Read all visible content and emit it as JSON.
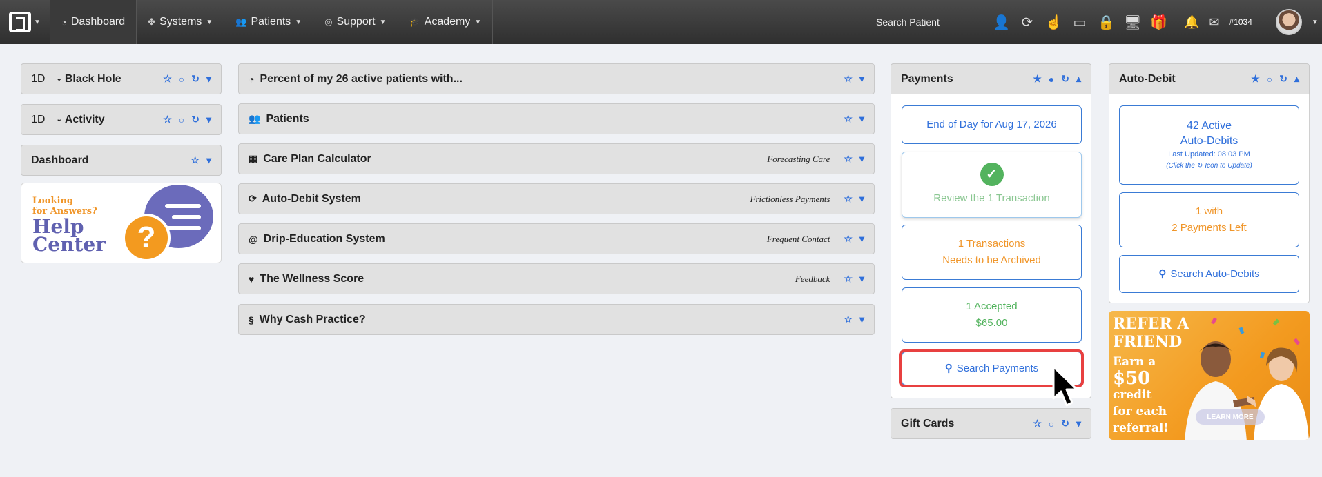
{
  "nav": {
    "items": [
      {
        "label": "Dashboard",
        "icon": "tachometer-icon"
      },
      {
        "label": "Systems",
        "icon": "puzzle-icon"
      },
      {
        "label": "Patients",
        "icon": "users-icon"
      },
      {
        "label": "Support",
        "icon": "life-ring-icon"
      },
      {
        "label": "Academy",
        "icon": "graduation-cap-icon"
      }
    ],
    "search_placeholder": "Search Patient",
    "account_number": "#1034"
  },
  "left_col": {
    "black_hole": {
      "range": "1D",
      "title": "Black Hole"
    },
    "activity": {
      "range": "1D",
      "title": "Activity"
    },
    "dashboard": {
      "title": "Dashboard"
    },
    "help_center": {
      "line1": "Looking",
      "line2": "for Answers?",
      "line3": "Help",
      "line4": "Center"
    }
  },
  "middle_col": {
    "panels": [
      {
        "title": "Percent of my 26 active patients with...",
        "subtitle": ""
      },
      {
        "title": "Patients",
        "subtitle": ""
      },
      {
        "title": "Care Plan Calculator",
        "subtitle": "Forecasting Care"
      },
      {
        "title": "Auto-Debit System",
        "subtitle": "Frictionless Payments"
      },
      {
        "title": "Drip-Education System",
        "subtitle": "Frequent Contact"
      },
      {
        "title": "The Wellness Score",
        "subtitle": "Feedback"
      },
      {
        "title": "Why Cash Practice?",
        "subtitle": ""
      }
    ]
  },
  "payments": {
    "title": "Payments",
    "end_of_day": "End of Day for Aug 17, 2026",
    "review": "Review the 1 Transaction",
    "archive_line1": "1 Transactions",
    "archive_line2": "Needs to be Archived",
    "accepted_line1": "1 Accepted",
    "accepted_line2": "$65.00",
    "search": "Search Payments"
  },
  "gift_cards": {
    "title": "Gift Cards"
  },
  "auto_debit": {
    "title": "Auto-Debit",
    "active_line1": "42 Active",
    "active_line2": "Auto-Debits",
    "last_updated": "Last Updated: 08:03 PM",
    "hint_pre": "(Click the",
    "hint_post": "Icon to Update)",
    "left_line1": "1 with",
    "left_line2": "2 Payments Left",
    "search": "Search Auto-Debits"
  },
  "refer": {
    "headline1": "REFER A",
    "headline2": "FRIEND",
    "body1": "Earn a",
    "body2": "$50",
    "body3": "credit",
    "body4": "for each",
    "body5": "referral!",
    "cta": "LEARN MORE"
  }
}
